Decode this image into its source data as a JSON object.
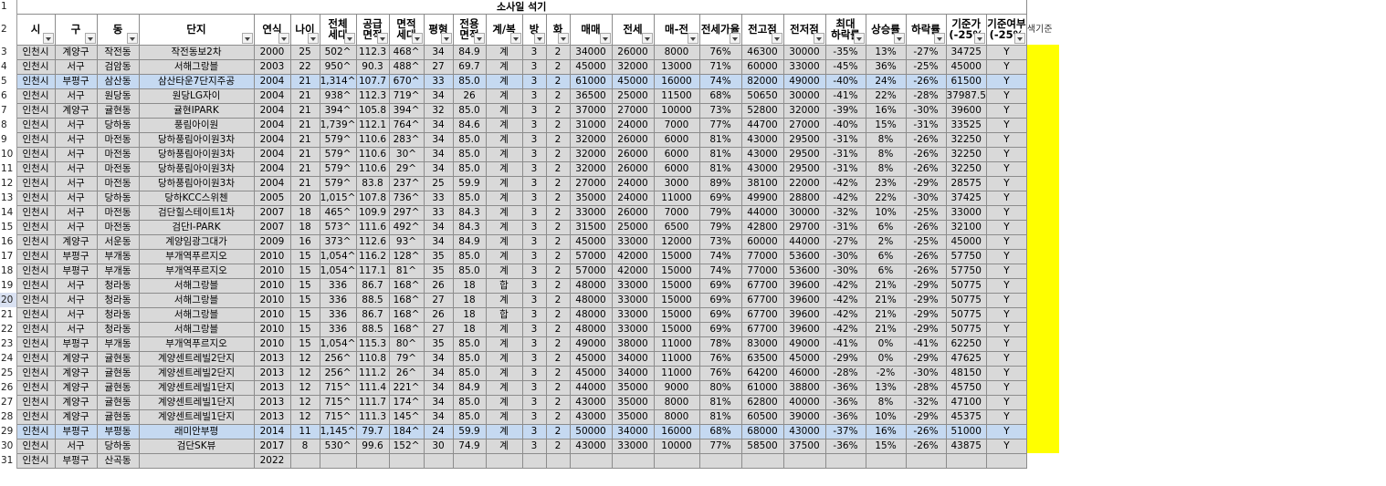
{
  "title": "소사일 석기",
  "side_label": "색기준",
  "row_numbers": [
    "1",
    "2",
    "3",
    "4",
    "5",
    "6",
    "7",
    "8",
    "9",
    "10",
    "11",
    "12",
    "13",
    "14",
    "15",
    "16",
    "17",
    "18",
    "19",
    "20",
    "21",
    "22",
    "23",
    "24",
    "25",
    "26",
    "27",
    "28",
    "29",
    "30",
    "31"
  ],
  "headers": [
    [
      "시"
    ],
    [
      "구"
    ],
    [
      "동"
    ],
    [
      "단지"
    ],
    [
      "연식"
    ],
    [
      "나이"
    ],
    [
      "전체",
      "세대"
    ],
    [
      "공급",
      "면적"
    ],
    [
      "면적",
      "세대"
    ],
    [
      "평형"
    ],
    [
      "전용",
      "면적"
    ],
    [
      "계/복"
    ],
    [
      "방"
    ],
    [
      "화"
    ],
    [
      "매매"
    ],
    [
      "전세"
    ],
    [
      "매-전"
    ],
    [
      "전세가율"
    ],
    [
      "전고점"
    ],
    [
      "전저점"
    ],
    [
      "최대",
      "하락률"
    ],
    [
      "상승률"
    ],
    [
      "하락률"
    ],
    [
      "기준가",
      "(-25%"
    ],
    [
      "기준여부",
      "(-25%"
    ]
  ],
  "rows": [
    [
      "인천시",
      "계양구",
      "작전동",
      "작전동보2차",
      "2000",
      "25",
      "502^",
      "112.3",
      "468^",
      "34",
      "84.9",
      "계",
      "3",
      "2",
      "34000",
      "26000",
      "8000",
      "76%",
      "46300",
      "30000",
      "-35%",
      "13%",
      "-27%",
      "34725",
      "Y"
    ],
    [
      "인천시",
      "서구",
      "검암동",
      "서해그랑블",
      "2003",
      "22",
      "950^",
      "90.3",
      "488^",
      "27",
      "69.7",
      "계",
      "3",
      "2",
      "45000",
      "32000",
      "13000",
      "71%",
      "60000",
      "33000",
      "-45%",
      "36%",
      "-25%",
      "45000",
      "Y"
    ],
    [
      "인천시",
      "부평구",
      "삼산동",
      "삼산타운7단지주공",
      "2004",
      "21",
      "1,314^",
      "107.7",
      "670^",
      "33",
      "85.0",
      "계",
      "3",
      "2",
      "61000",
      "45000",
      "16000",
      "74%",
      "82000",
      "49000",
      "-40%",
      "24%",
      "-26%",
      "61500",
      "Y"
    ],
    [
      "인천시",
      "서구",
      "원당동",
      "원당LG자이",
      "2004",
      "21",
      "938^",
      "112.3",
      "719^",
      "34",
      "26",
      "계",
      "3",
      "2",
      "36500",
      "25000",
      "11500",
      "68%",
      "50650",
      "30000",
      "-41%",
      "22%",
      "-28%",
      "37987.5",
      "Y"
    ],
    [
      "인천시",
      "계양구",
      "귤현동",
      "귤현IPARK",
      "2004",
      "21",
      "394^",
      "105.8",
      "394^",
      "32",
      "85.0",
      "계",
      "3",
      "2",
      "37000",
      "27000",
      "10000",
      "73%",
      "52800",
      "32000",
      "-39%",
      "16%",
      "-30%",
      "39600",
      "Y"
    ],
    [
      "인천시",
      "서구",
      "당하동",
      "풍림아이원",
      "2004",
      "21",
      "1,739^",
      "112.1",
      "764^",
      "34",
      "84.6",
      "계",
      "3",
      "2",
      "31000",
      "24000",
      "7000",
      "77%",
      "44700",
      "27000",
      "-40%",
      "15%",
      "-31%",
      "33525",
      "Y"
    ],
    [
      "인천시",
      "서구",
      "마전동",
      "당하풍림아이원3차",
      "2004",
      "21",
      "579^",
      "110.6",
      "283^",
      "34",
      "85.0",
      "계",
      "3",
      "2",
      "32000",
      "26000",
      "6000",
      "81%",
      "43000",
      "29500",
      "-31%",
      "8%",
      "-26%",
      "32250",
      "Y"
    ],
    [
      "인천시",
      "서구",
      "마전동",
      "당하풍림아이원3차",
      "2004",
      "21",
      "579^",
      "110.6",
      "30^",
      "34",
      "85.0",
      "계",
      "3",
      "2",
      "32000",
      "26000",
      "6000",
      "81%",
      "43000",
      "29500",
      "-31%",
      "8%",
      "-26%",
      "32250",
      "Y"
    ],
    [
      "인천시",
      "서구",
      "마전동",
      "당하풍림아이원3차",
      "2004",
      "21",
      "579^",
      "110.6",
      "29^",
      "34",
      "85.0",
      "계",
      "3",
      "2",
      "32000",
      "26000",
      "6000",
      "81%",
      "43000",
      "29500",
      "-31%",
      "8%",
      "-26%",
      "32250",
      "Y"
    ],
    [
      "인천시",
      "서구",
      "마전동",
      "당하풍림아이원3차",
      "2004",
      "21",
      "579^",
      "83.8",
      "237^",
      "25",
      "59.9",
      "계",
      "3",
      "2",
      "27000",
      "24000",
      "3000",
      "89%",
      "38100",
      "22000",
      "-42%",
      "23%",
      "-29%",
      "28575",
      "Y"
    ],
    [
      "인천시",
      "서구",
      "당하동",
      "당하KCC스위첸",
      "2005",
      "20",
      "1,015^",
      "107.8",
      "736^",
      "33",
      "85.0",
      "계",
      "3",
      "2",
      "35000",
      "24000",
      "11000",
      "69%",
      "49900",
      "28800",
      "-42%",
      "22%",
      "-30%",
      "37425",
      "Y"
    ],
    [
      "인천시",
      "서구",
      "마전동",
      "검단힐스테이트1차",
      "2007",
      "18",
      "465^",
      "109.9",
      "297^",
      "33",
      "84.3",
      "계",
      "3",
      "2",
      "33000",
      "26000",
      "7000",
      "79%",
      "44000",
      "30000",
      "-32%",
      "10%",
      "-25%",
      "33000",
      "Y"
    ],
    [
      "인천시",
      "서구",
      "마전동",
      "검단I-PARK",
      "2007",
      "18",
      "573^",
      "111.6",
      "492^",
      "34",
      "84.3",
      "계",
      "3",
      "2",
      "31500",
      "25000",
      "6500",
      "79%",
      "42800",
      "29700",
      "-31%",
      "6%",
      "-26%",
      "32100",
      "Y"
    ],
    [
      "인천시",
      "계양구",
      "서운동",
      "계양임광그대가",
      "2009",
      "16",
      "373^",
      "112.6",
      "93^",
      "34",
      "84.9",
      "계",
      "3",
      "2",
      "45000",
      "33000",
      "12000",
      "73%",
      "60000",
      "44000",
      "-27%",
      "2%",
      "-25%",
      "45000",
      "Y"
    ],
    [
      "인천시",
      "부평구",
      "부개동",
      "부개역푸르지오",
      "2010",
      "15",
      "1,054^",
      "116.2",
      "128^",
      "35",
      "85.0",
      "계",
      "3",
      "2",
      "57000",
      "42000",
      "15000",
      "74%",
      "77000",
      "53600",
      "-30%",
      "6%",
      "-26%",
      "57750",
      "Y"
    ],
    [
      "인천시",
      "부평구",
      "부개동",
      "부개역푸르지오",
      "2010",
      "15",
      "1,054^",
      "117.1",
      "81^",
      "35",
      "85.0",
      "계",
      "3",
      "2",
      "57000",
      "42000",
      "15000",
      "74%",
      "77000",
      "53600",
      "-30%",
      "6%",
      "-26%",
      "57750",
      "Y"
    ],
    [
      "인천시",
      "서구",
      "청라동",
      "서해그랑블",
      "2010",
      "15",
      "336",
      "86.7",
      "168^",
      "26",
      "18",
      "합",
      "3",
      "2",
      "48000",
      "33000",
      "15000",
      "69%",
      "67700",
      "39600",
      "-42%",
      "21%",
      "-29%",
      "50775",
      "Y"
    ],
    [
      "인천시",
      "서구",
      "청라동",
      "서해그랑블",
      "2010",
      "15",
      "336",
      "88.5",
      "168^",
      "27",
      "18",
      "계",
      "3",
      "2",
      "48000",
      "33000",
      "15000",
      "69%",
      "67700",
      "39600",
      "-42%",
      "21%",
      "-29%",
      "50775",
      "Y"
    ],
    [
      "인천시",
      "서구",
      "청라동",
      "서해그랑블",
      "2010",
      "15",
      "336",
      "86.7",
      "168^",
      "26",
      "18",
      "합",
      "3",
      "2",
      "48000",
      "33000",
      "15000",
      "69%",
      "67700",
      "39600",
      "-42%",
      "21%",
      "-29%",
      "50775",
      "Y"
    ],
    [
      "인천시",
      "서구",
      "청라동",
      "서해그랑블",
      "2010",
      "15",
      "336",
      "88.5",
      "168^",
      "27",
      "18",
      "계",
      "3",
      "2",
      "48000",
      "33000",
      "15000",
      "69%",
      "67700",
      "39600",
      "-42%",
      "21%",
      "-29%",
      "50775",
      "Y"
    ],
    [
      "인천시",
      "부평구",
      "부개동",
      "부개역푸르지오",
      "2010",
      "15",
      "1,054^",
      "115.3",
      "80^",
      "35",
      "85.0",
      "계",
      "3",
      "2",
      "49000",
      "38000",
      "11000",
      "78%",
      "83000",
      "49000",
      "-41%",
      "0%",
      "-41%",
      "62250",
      "Y"
    ],
    [
      "인천시",
      "계양구",
      "귤현동",
      "계양센트레빌2단지",
      "2013",
      "12",
      "256^",
      "110.8",
      "79^",
      "34",
      "85.0",
      "계",
      "3",
      "2",
      "45000",
      "34000",
      "11000",
      "76%",
      "63500",
      "45000",
      "-29%",
      "0%",
      "-29%",
      "47625",
      "Y"
    ],
    [
      "인천시",
      "계양구",
      "귤현동",
      "계양센트레빌2단지",
      "2013",
      "12",
      "256^",
      "111.2",
      "26^",
      "34",
      "85.0",
      "계",
      "3",
      "2",
      "45000",
      "34000",
      "11000",
      "76%",
      "64200",
      "46000",
      "-28%",
      "-2%",
      "-30%",
      "48150",
      "Y"
    ],
    [
      "인천시",
      "계양구",
      "귤현동",
      "계양센트레빌1단지",
      "2013",
      "12",
      "715^",
      "111.4",
      "221^",
      "34",
      "84.9",
      "계",
      "3",
      "2",
      "44000",
      "35000",
      "9000",
      "80%",
      "61000",
      "38800",
      "-36%",
      "13%",
      "-28%",
      "45750",
      "Y"
    ],
    [
      "인천시",
      "계양구",
      "귤현동",
      "계양센트레빌1단지",
      "2013",
      "12",
      "715^",
      "111.7",
      "174^",
      "34",
      "85.0",
      "계",
      "3",
      "2",
      "43000",
      "35000",
      "8000",
      "81%",
      "62800",
      "40000",
      "-36%",
      "8%",
      "-32%",
      "47100",
      "Y"
    ],
    [
      "인천시",
      "계양구",
      "귤현동",
      "계양센트레빌1단지",
      "2013",
      "12",
      "715^",
      "111.3",
      "145^",
      "34",
      "85.0",
      "계",
      "3",
      "2",
      "43000",
      "35000",
      "8000",
      "81%",
      "60500",
      "39000",
      "-36%",
      "10%",
      "-29%",
      "45375",
      "Y"
    ],
    [
      "인천시",
      "부평구",
      "부평동",
      "래미안부평",
      "2014",
      "11",
      "1,145^",
      "79.7",
      "184^",
      "24",
      "59.9",
      "계",
      "3",
      "2",
      "50000",
      "34000",
      "16000",
      "68%",
      "68000",
      "43000",
      "-37%",
      "16%",
      "-26%",
      "51000",
      "Y"
    ],
    [
      "인천시",
      "서구",
      "당하동",
      "검단SK뷰",
      "2017",
      "8",
      "530^",
      "99.6",
      "152^",
      "30",
      "74.9",
      "계",
      "3",
      "2",
      "43000",
      "33000",
      "10000",
      "77%",
      "58500",
      "37500",
      "-36%",
      "15%",
      "-26%",
      "43875",
      "Y"
    ],
    [
      "인천시",
      "부평구",
      "산곡동",
      "",
      "2022",
      "",
      "",
      "",
      "",
      "",
      "",
      "",
      "",
      "",
      "",
      "",
      "",
      "",
      "",
      "",
      "",
      "",
      "",
      "",
      ""
    ]
  ]
}
